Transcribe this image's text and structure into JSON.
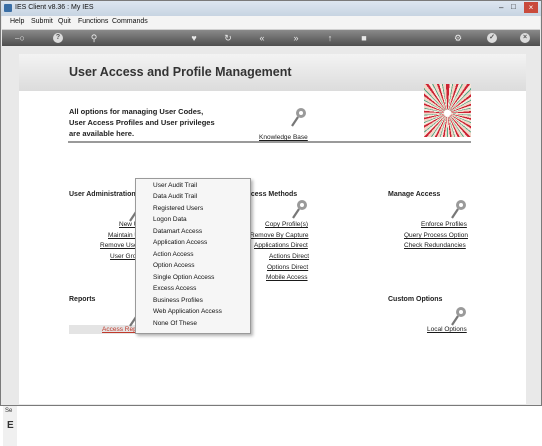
{
  "window": {
    "title": "IES Client v8.36 : My IES"
  },
  "menubar": {
    "items": [
      "Help",
      "Submit",
      "Quit",
      "Functions",
      "Commands"
    ]
  },
  "toolbar": {
    "help_label": "?",
    "info_label": "i"
  },
  "page": {
    "title": "User Access and Profile Management",
    "intro": [
      "All options for managing User Codes,",
      "User Access Profiles and User privileges",
      "are available here."
    ],
    "knowledge_base": "Knowledge Base"
  },
  "sections": {
    "user_admin": {
      "heading": "User Administration",
      "links": [
        "New U",
        "Maintain U",
        "Remove Use",
        "User Gro"
      ]
    },
    "access_methods": {
      "heading": "ccess Methods",
      "links": [
        "Copy Profile(s)",
        "Remove By Capture",
        "Applications Direct",
        "Actions Direct",
        "Options Direct",
        "Mobile Access"
      ]
    },
    "manage_access": {
      "heading": "Manage Access",
      "links": [
        "Enforce Profiles",
        "Query Process Option",
        "Check Redundancies"
      ]
    },
    "reports": {
      "heading": "Reports",
      "links": [
        "Access Rep"
      ]
    },
    "custom_options": {
      "heading": "Custom Options",
      "links": [
        "Local Options"
      ]
    }
  },
  "dropdown": {
    "items": [
      "User Audit Trail",
      "Data Audit Trail",
      "Registered Users",
      "Logon Data",
      "Datamart Access",
      "Application Access",
      "Action Access",
      "Option Access",
      "Single Option Access",
      "Excess Access",
      "Business Profiles",
      "Web Application Access",
      "None Of These"
    ]
  },
  "statusbar": {
    "left_label": "Se",
    "left_glyph": "E"
  },
  "colors": {
    "toolbar": "#5a5a5a",
    "report_link": "#c0392b",
    "divider": "#9a9a9a"
  }
}
